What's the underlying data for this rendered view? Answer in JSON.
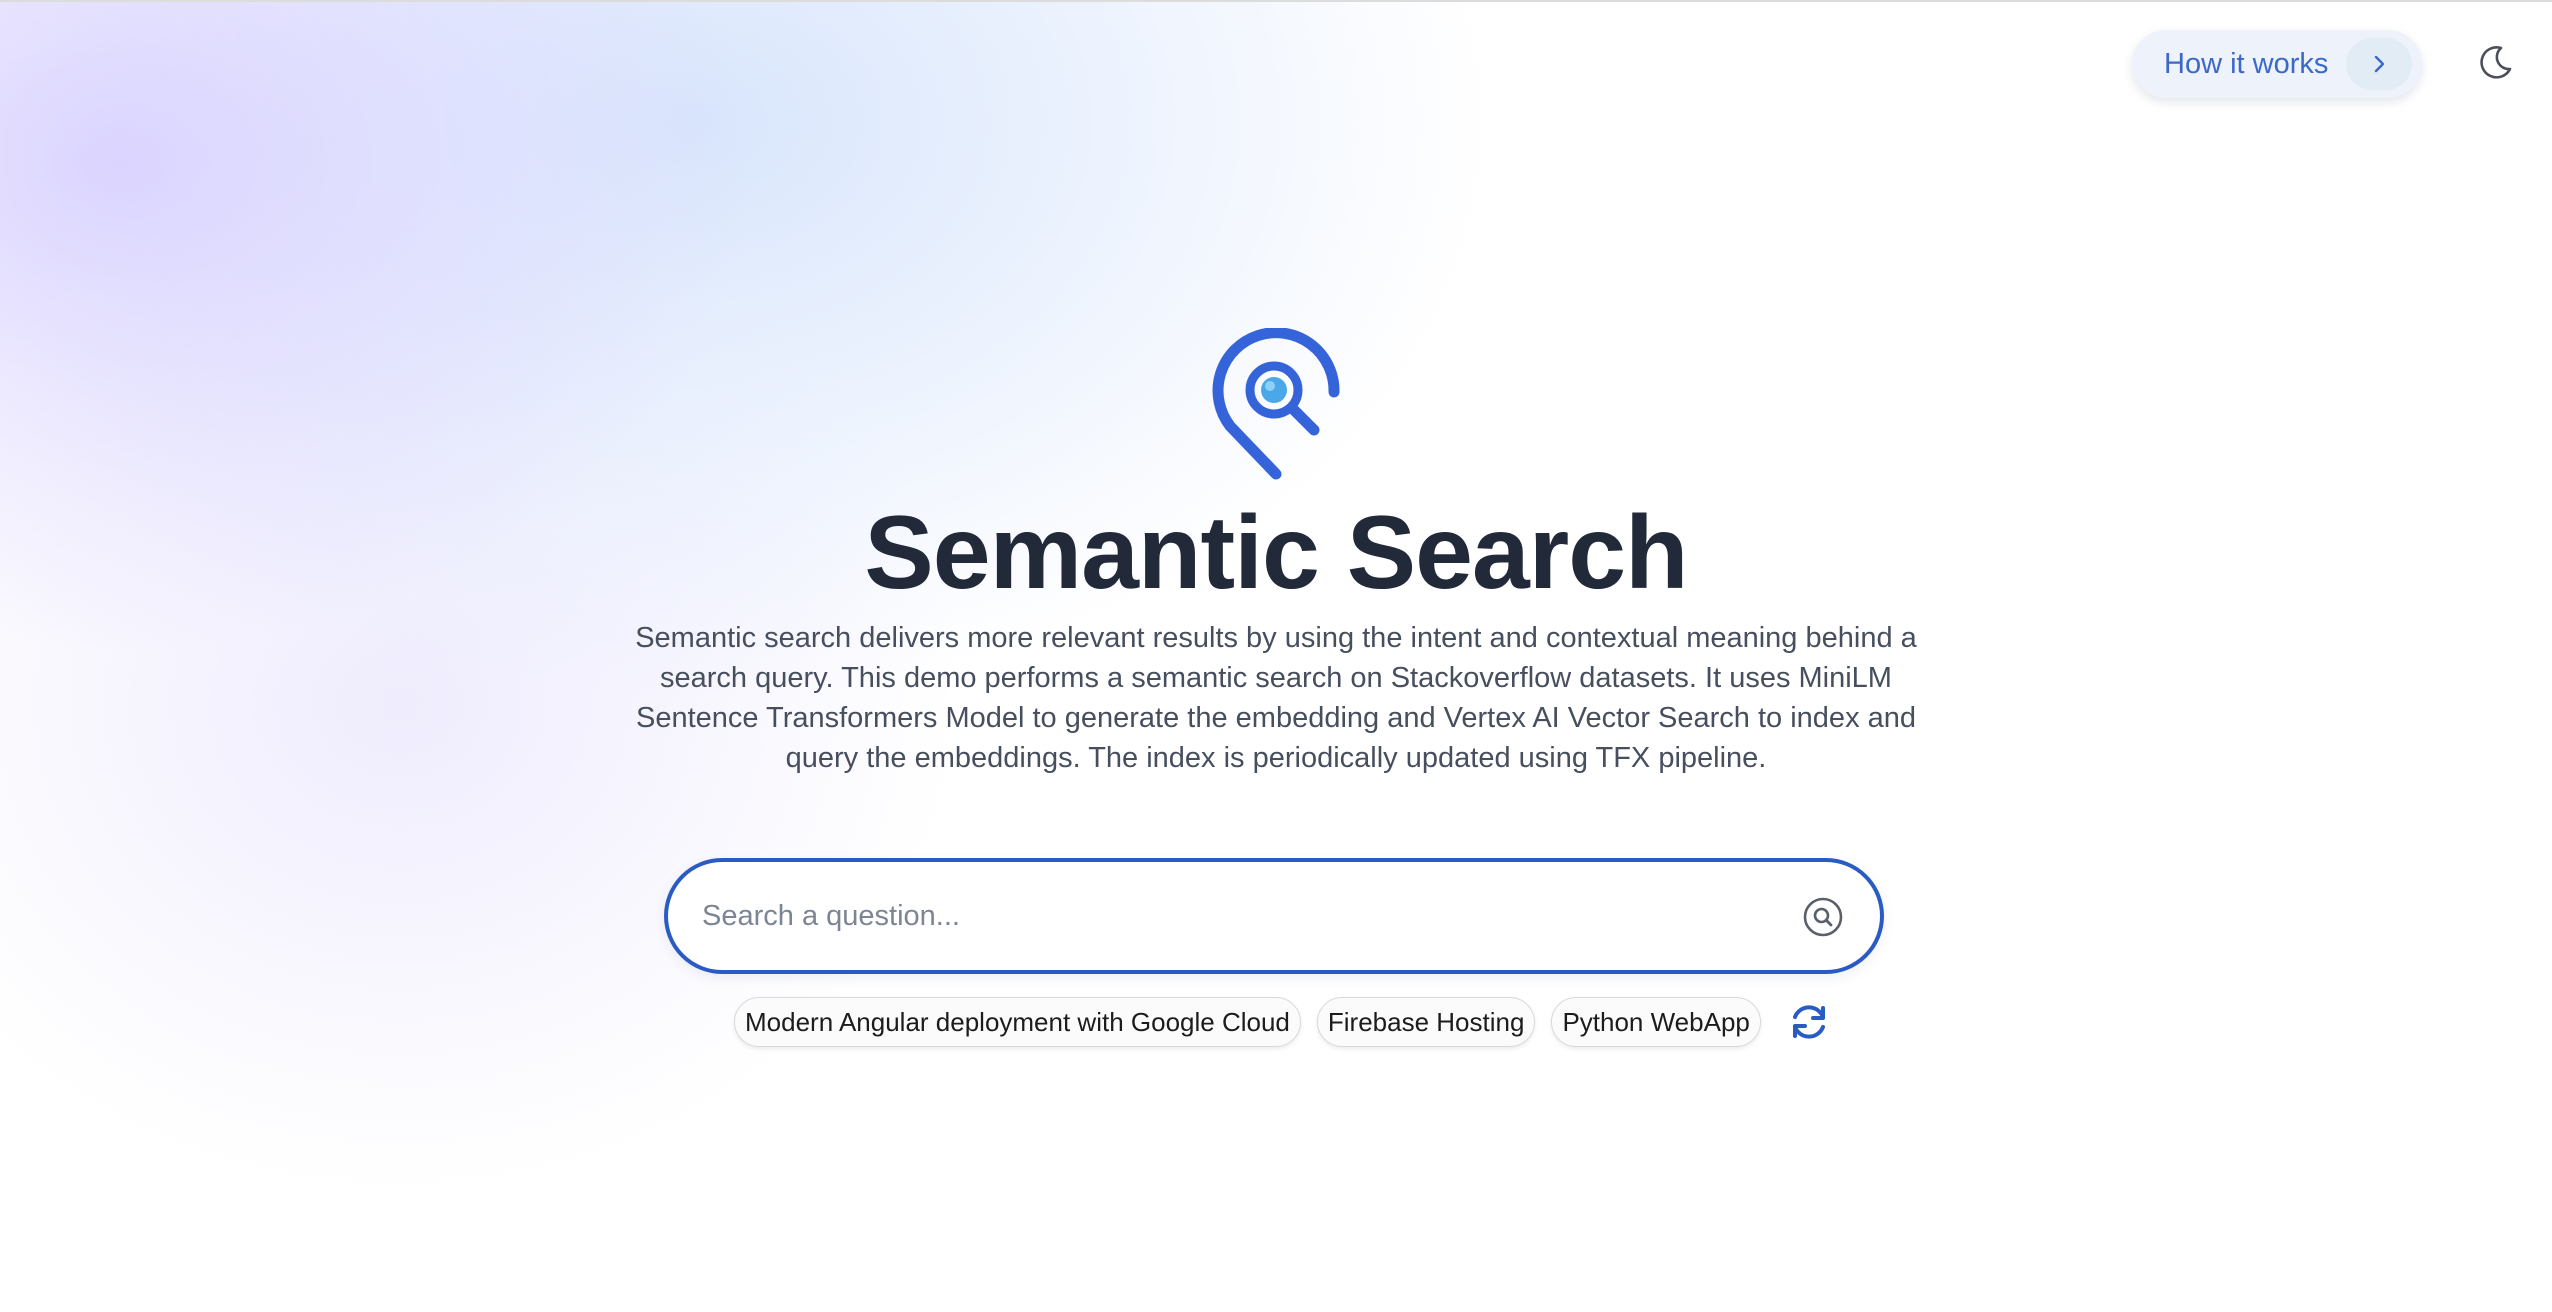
{
  "header": {
    "how_it_works_label": "How it works",
    "chevron_icon": "chevron-right-icon",
    "theme_icon": "moon-icon"
  },
  "hero": {
    "logo_icon": "location-pin-search-icon",
    "title": "Semantic Search",
    "description": "Semantic search delivers more relevant results by using the intent and contextual meaning behind a search query. This demo performs a semantic search on Stackoverflow datasets. It uses MiniLM Sentence Transformers Model to generate the embedding and Vertex AI Vector Search to index and query the embeddings. The index is periodically updated using TFX pipeline."
  },
  "search": {
    "placeholder": "Search a question...",
    "value": "",
    "icon": "search-icon"
  },
  "suggestions": [
    "Modern Angular deployment with Google Cloud",
    "Firebase Hosting",
    "Python WebApp"
  ],
  "refresh_icon": "refresh-icon",
  "colors": {
    "accent": "#2a5bc4",
    "logo_blue": "#3563d9",
    "logo_inner": "#4aa8e8",
    "title": "#222a3a",
    "text": "#474f5f"
  }
}
